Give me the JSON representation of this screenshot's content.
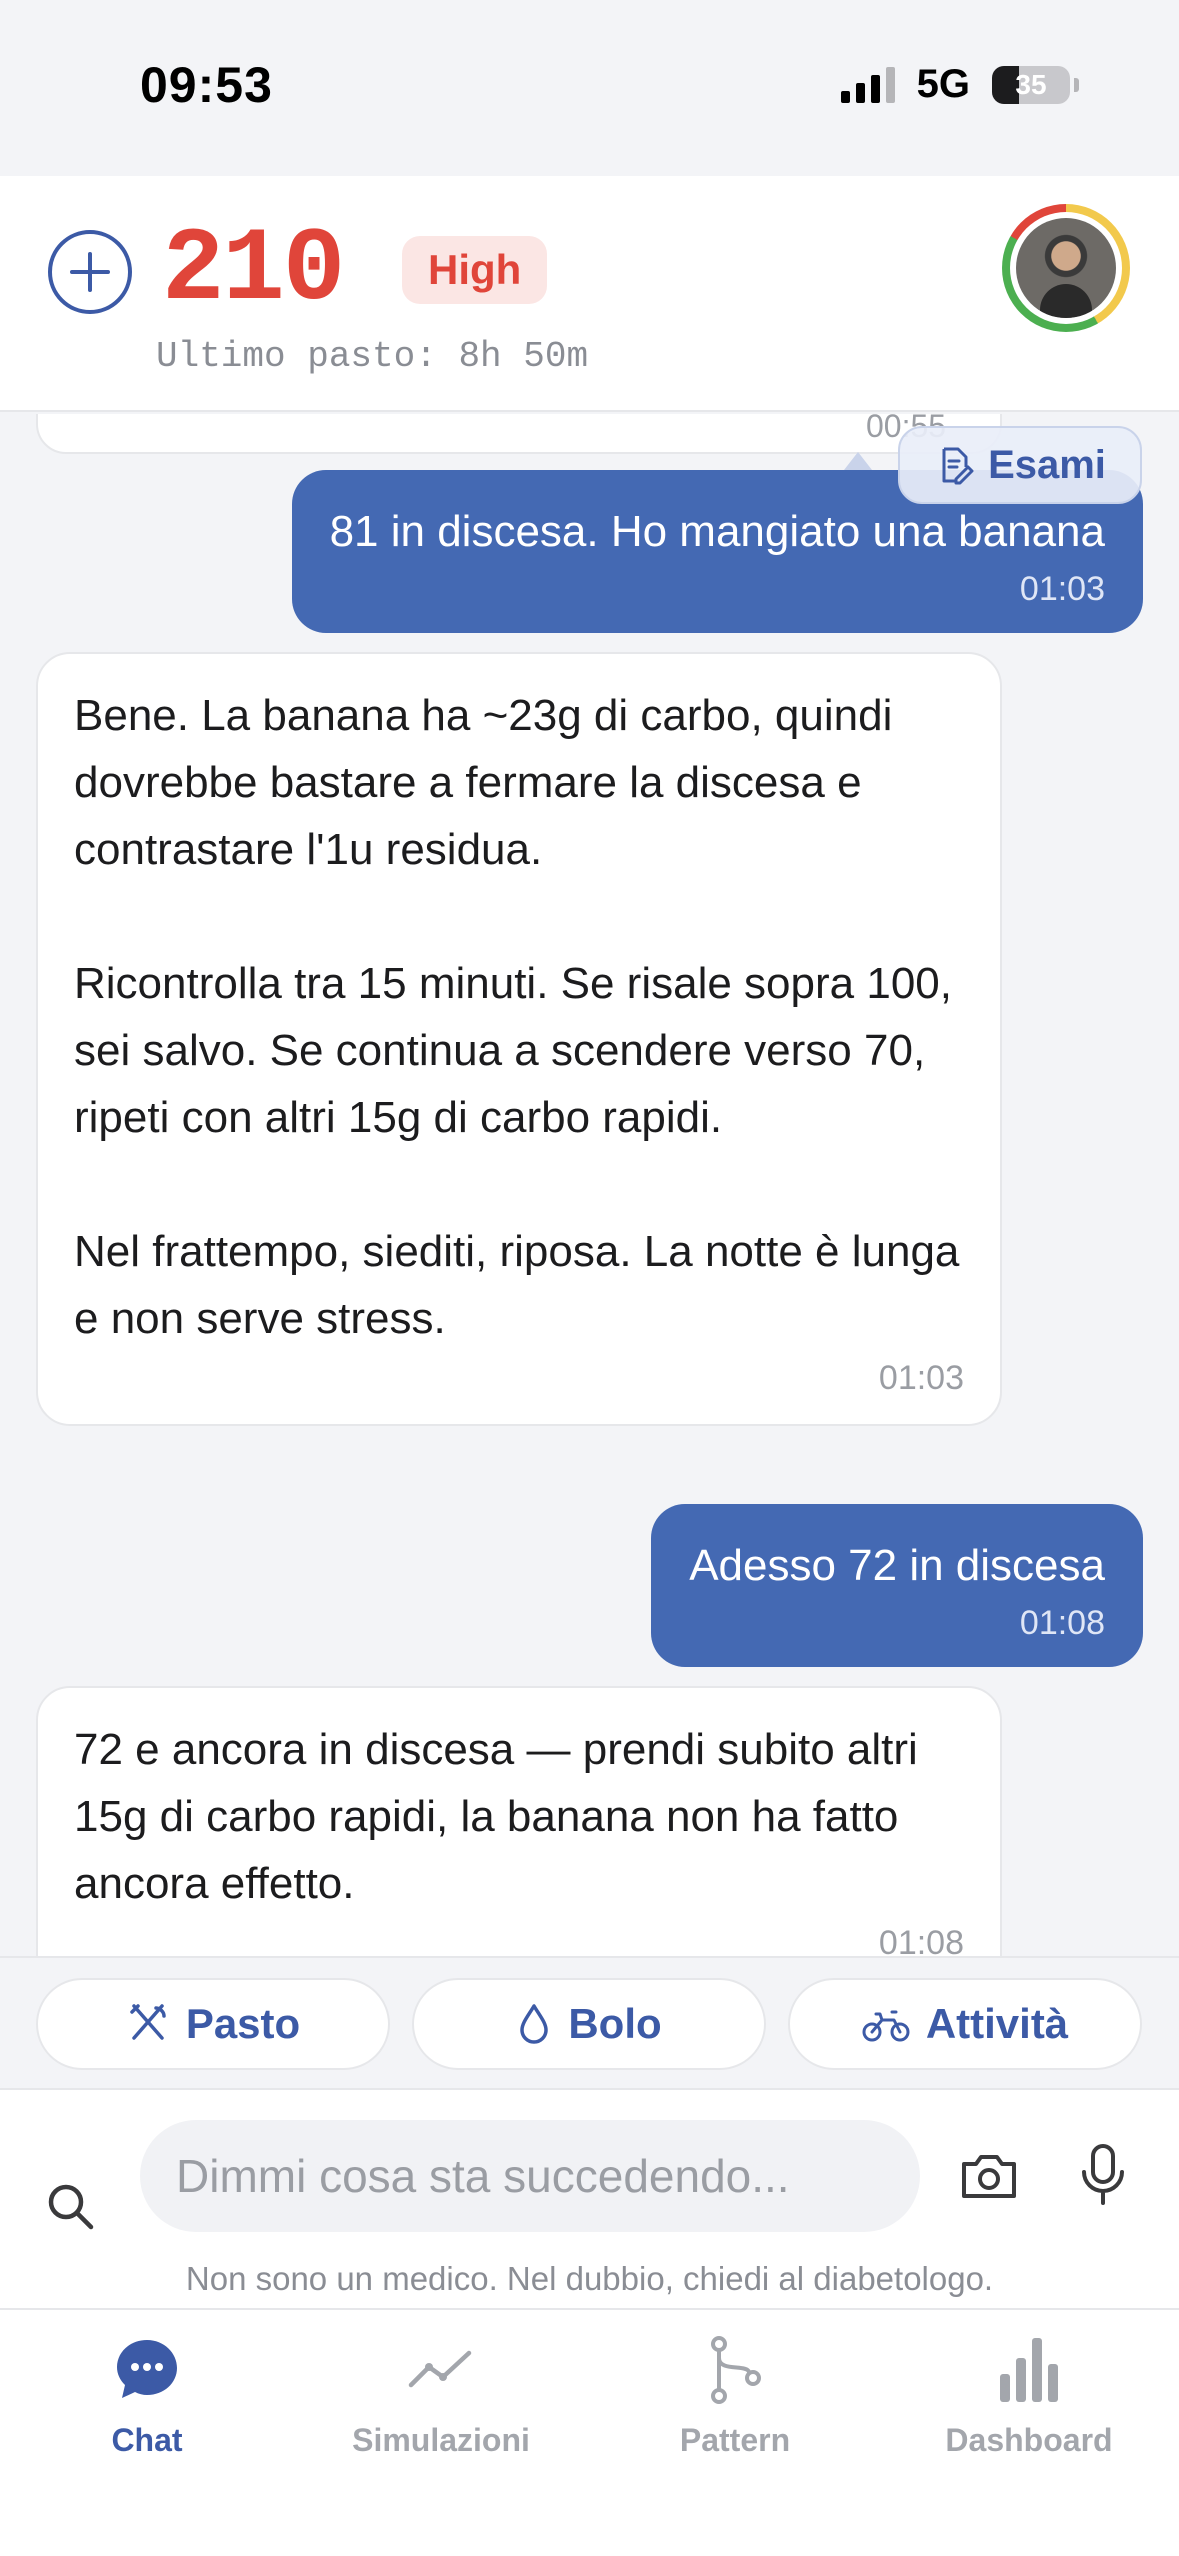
{
  "status_bar": {
    "time": "09:53",
    "network": "5G",
    "battery": "35",
    "battery_level": 0.35,
    "signal_bars": 3
  },
  "header": {
    "glucose_value": "210",
    "status_badge": "High",
    "last_meal": "Ultimo pasto: 8h 50m",
    "colors": {
      "high": "#e0453a",
      "accent": "#3c5aa6"
    }
  },
  "chat": {
    "previous_time": "00:55",
    "esami_label": "Esami",
    "messages": [
      {
        "from": "user",
        "text": "81 in discesa. Ho mangiato una banana",
        "time": "01:03"
      },
      {
        "from": "assistant",
        "paragraphs": [
          "Bene. La banana ha ~23g di carbo, quindi dovrebbe bastare a fermare la discesa e contrastare l'1u residua.",
          "Ricontrolla tra 15 minuti. Se risale sopra 100, sei salvo. Se continua a scendere verso 70, ripeti con altri 15g di carbo rapidi.",
          "Nel frattempo, siediti, riposa. La notte è lunga e non serve stress."
        ],
        "time": "01:03"
      },
      {
        "from": "user",
        "text": "Adesso 72 in discesa",
        "time": "01:08"
      },
      {
        "from": "assistant",
        "paragraphs": [
          "72 e ancora in discesa — prendi subito altri 15g di carbo rapidi, la banana non ha fatto ancora effetto."
        ],
        "time": "01:08"
      }
    ]
  },
  "quick_actions": [
    {
      "label": "Pasto",
      "icon": "utensils-icon"
    },
    {
      "label": "Bolo",
      "icon": "drop-icon"
    },
    {
      "label": "Attività",
      "icon": "bike-icon"
    }
  ],
  "input": {
    "placeholder": "Dimmi cosa sta succedendo...",
    "value": "",
    "disclaimer": "Non sono un medico. Nel dubbio, chiedi al diabetologo."
  },
  "tabs": [
    {
      "label": "Chat",
      "icon": "chat-bubble-icon",
      "active": true
    },
    {
      "label": "Simulazioni",
      "icon": "line-chart-icon",
      "active": false
    },
    {
      "label": "Pattern",
      "icon": "branch-icon",
      "active": false
    },
    {
      "label": "Dashboard",
      "icon": "bar-chart-icon",
      "active": false
    }
  ]
}
